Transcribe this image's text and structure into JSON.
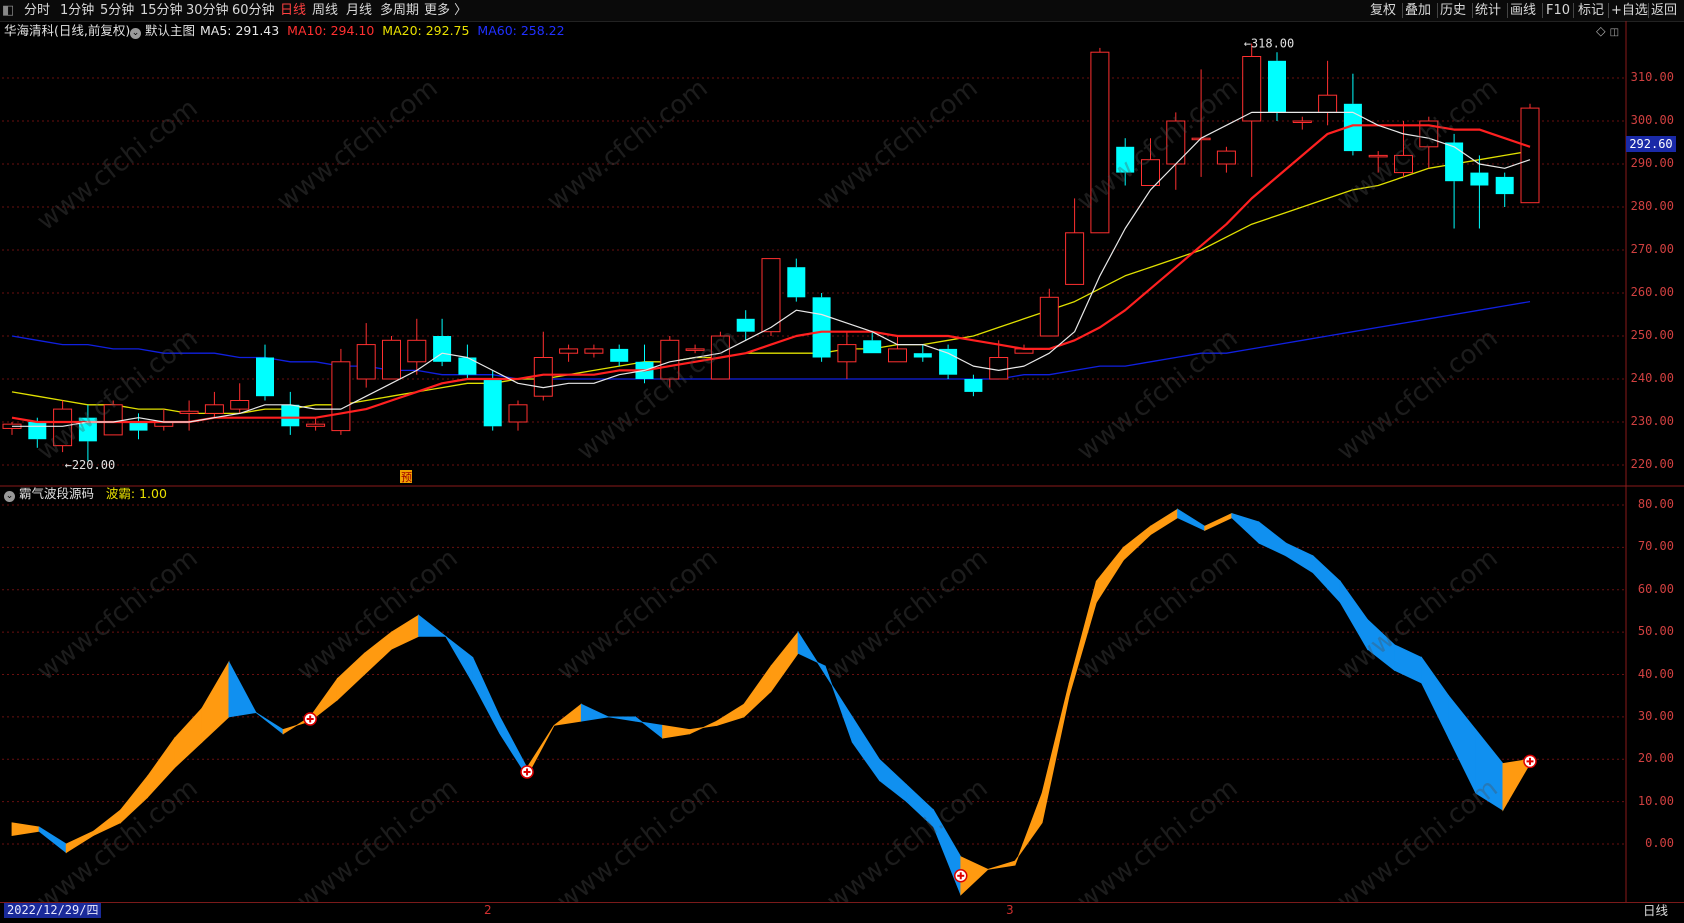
{
  "toolbar": {
    "timeframes": [
      "分时",
      "1分钟",
      "5分钟",
      "15分钟",
      "30分钟",
      "60分钟",
      "日线",
      "周线",
      "月线",
      "多周期",
      "更多 〉"
    ],
    "active_timeframe": "日线",
    "actions": [
      "复权",
      "叠加",
      "历史",
      "统计",
      "画线",
      "F10",
      "标记",
      "+自选",
      "返回"
    ]
  },
  "main_panel": {
    "stock_name": "华海清科(日线,前复权)",
    "template": "默认主图",
    "ma_labels": [
      {
        "text": "MA5: 291.43",
        "color": "#e8e8e8"
      },
      {
        "text": "MA10: 294.10",
        "color": "#ff3030"
      },
      {
        "text": "MA20: 292.75",
        "color": "#e8e000"
      },
      {
        "text": "MA60: 258.22",
        "color": "#2030ff"
      }
    ],
    "price_ticks": [
      "310.00",
      "300.00",
      "290.00",
      "280.00",
      "270.00",
      "260.00",
      "250.00",
      "240.00",
      "230.00",
      "220.00"
    ],
    "current_price": "292.60",
    "high_label": "318.00",
    "low_label": "220.00",
    "yu_label": "预"
  },
  "sub_panel": {
    "indicator_name": "霸气波段源码",
    "param_label": "波霸: 1.00",
    "ticks": [
      "80.00",
      "70.00",
      "60.00",
      "50.00",
      "40.00",
      "30.00",
      "20.00",
      "10.00",
      "0.00"
    ]
  },
  "bottom": {
    "date": "2022/12/29/四",
    "month_marks": [
      "2",
      "3"
    ],
    "period": "日线"
  },
  "watermark_text": "www.cfchi.com",
  "colors": {
    "up": "#ff3030",
    "down": "#00ffff",
    "ma5": "#e8e8e8",
    "ma10": "#ff2020",
    "ma20": "#e0e000",
    "ma60": "#1020e0",
    "band_up": "#ff9a10",
    "band_down": "#1090f0",
    "grid": "#6a1010"
  },
  "chart_data": [
    {
      "type": "candlestick",
      "title": "华海清科(日线,前复权)",
      "ylim": [
        215,
        318
      ],
      "candles": [
        [
          228.5,
          229.5,
          227,
          230
        ],
        [
          230,
          226,
          224,
          231
        ],
        [
          224.5,
          233,
          223,
          235
        ],
        [
          231,
          225.5,
          221,
          234
        ],
        [
          227,
          234,
          228,
          235
        ],
        [
          230,
          228,
          226,
          232
        ],
        [
          229,
          230,
          228,
          233
        ],
        [
          232,
          232.5,
          228,
          235
        ],
        [
          232,
          234,
          231,
          237
        ],
        [
          233,
          235,
          232,
          239
        ],
        [
          245,
          236,
          235,
          248
        ],
        [
          234,
          229,
          227,
          237
        ],
        [
          229,
          229.5,
          228,
          231
        ],
        [
          228,
          244,
          227,
          247
        ],
        [
          240,
          248,
          238,
          253
        ],
        [
          240,
          249,
          240,
          250
        ],
        [
          244,
          249,
          241,
          254
        ],
        [
          250,
          244,
          243,
          254
        ],
        [
          245,
          241,
          240,
          248
        ],
        [
          240,
          229,
          228,
          242
        ],
        [
          230,
          234,
          228,
          235
        ],
        [
          236,
          245,
          235,
          251
        ],
        [
          246,
          247,
          244,
          248
        ],
        [
          246,
          247,
          245,
          248
        ],
        [
          247,
          244,
          243,
          248
        ],
        [
          244,
          240,
          239,
          248
        ],
        [
          240,
          249,
          238,
          250
        ],
        [
          247,
          247,
          246,
          248
        ],
        [
          240,
          250,
          240,
          251
        ],
        [
          254,
          251,
          249,
          256
        ],
        [
          251,
          268,
          250,
          268
        ],
        [
          266,
          259,
          258,
          268
        ],
        [
          259,
          245,
          244,
          260
        ],
        [
          244,
          248,
          240,
          251
        ],
        [
          249,
          246,
          246,
          251
        ],
        [
          244,
          247,
          244,
          250
        ],
        [
          246,
          245,
          244,
          248
        ],
        [
          247,
          241,
          240,
          248
        ],
        [
          240,
          237,
          236,
          241
        ],
        [
          240,
          245,
          240,
          249
        ],
        [
          246,
          247,
          246,
          248
        ],
        [
          250,
          259,
          250,
          261
        ],
        [
          262,
          274,
          262,
          282
        ],
        [
          274,
          316,
          274,
          317
        ],
        [
          294,
          288,
          285,
          296
        ],
        [
          285,
          291,
          285,
          296
        ],
        [
          290,
          300,
          284,
          302
        ],
        [
          296,
          296,
          287,
          312
        ],
        [
          290,
          293,
          288,
          294
        ],
        [
          300,
          315,
          287,
          318
        ],
        [
          314,
          302,
          300,
          316
        ],
        [
          300,
          300,
          298,
          301
        ],
        [
          302,
          306,
          299,
          314
        ],
        [
          304,
          293,
          292,
          311
        ],
        [
          292,
          292,
          288,
          293
        ],
        [
          288,
          292,
          287,
          300
        ],
        [
          294,
          300,
          289,
          301
        ],
        [
          295,
          286,
          275,
          297
        ],
        [
          288,
          285,
          275,
          292
        ],
        [
          287,
          283,
          280,
          288
        ],
        [
          281,
          303,
          281,
          304
        ]
      ],
      "ma5": [
        229,
        229,
        229,
        230,
        230,
        231,
        230,
        230,
        231,
        232,
        234,
        234,
        233,
        233,
        236,
        239,
        242,
        246,
        245,
        242,
        239,
        238,
        239,
        239,
        241,
        242,
        244,
        245,
        246,
        249,
        252,
        256,
        255,
        253,
        251,
        248,
        248,
        246,
        243,
        242,
        243,
        246,
        251,
        264,
        275,
        284,
        290,
        296,
        299,
        302,
        302,
        302,
        302,
        302,
        299,
        297,
        296,
        294,
        290,
        289,
        291
      ],
      "ma10": [
        231,
        230,
        230,
        230,
        230,
        230,
        230,
        230,
        231,
        231,
        231,
        231,
        231,
        232,
        233,
        235,
        237,
        239,
        240,
        240,
        240,
        241,
        241,
        241,
        242,
        242,
        243,
        244,
        245,
        246,
        248,
        250,
        251,
        251,
        251,
        250,
        250,
        250,
        249,
        248,
        247,
        247,
        249,
        252,
        256,
        261,
        266,
        271,
        276,
        282,
        287,
        292,
        297,
        299,
        299,
        299,
        299,
        298,
        298,
        296,
        294
      ],
      "ma20": [
        237,
        236,
        235,
        234,
        234,
        233,
        233,
        232,
        232,
        232,
        233,
        233,
        234,
        234,
        235,
        236,
        237,
        238,
        239,
        239,
        240,
        240,
        241,
        242,
        243,
        244,
        244,
        245,
        245,
        246,
        246,
        246,
        246,
        247,
        247,
        248,
        248,
        249,
        250,
        252,
        254,
        256,
        258,
        261,
        264,
        266,
        268,
        270,
        273,
        276,
        278,
        280,
        282,
        284,
        285,
        287,
        289,
        290,
        291,
        292,
        293
      ],
      "ma60": [
        250,
        249,
        248,
        248,
        247,
        247,
        246,
        246,
        246,
        245,
        245,
        244,
        244,
        243,
        243,
        242,
        242,
        241,
        241,
        241,
        240,
        240,
        240,
        240,
        240,
        240,
        240,
        240,
        240,
        240,
        240,
        240,
        240,
        240,
        240,
        240,
        240,
        240,
        240,
        240,
        241,
        241,
        242,
        243,
        243,
        244,
        245,
        246,
        246,
        247,
        248,
        249,
        250,
        251,
        252,
        253,
        254,
        255,
        256,
        257,
        258
      ]
    },
    {
      "type": "area",
      "title": "霸气波段源码",
      "ylim": [
        -12,
        82
      ],
      "series": [
        {
          "values": [
            5,
            4,
            0,
            3,
            8,
            16,
            25,
            32,
            43,
            31,
            26,
            30,
            39,
            45,
            50,
            54,
            49,
            44,
            30,
            18,
            28,
            33,
            30,
            30,
            25,
            26,
            29,
            33,
            42,
            50,
            40,
            30,
            20,
            14,
            8,
            -3,
            -6,
            -5,
            12,
            38,
            62,
            70,
            75,
            79,
            75,
            78,
            76,
            71,
            68,
            62,
            53,
            47,
            44,
            35,
            27,
            19,
            20
          ],
          "name": "上轨"
        },
        {
          "values": [
            2,
            3,
            -2,
            2,
            5,
            11,
            18,
            24,
            30,
            31,
            27,
            29,
            34,
            40,
            46,
            49,
            49,
            38,
            26,
            16,
            28,
            29,
            30,
            29,
            28,
            27,
            28,
            30,
            36,
            45,
            42,
            24,
            15,
            10,
            4,
            -12,
            -6,
            -4,
            5,
            35,
            57,
            67,
            73,
            77,
            74,
            77,
            71,
            68,
            64,
            57,
            46,
            41,
            38,
            25,
            12,
            8,
            19
          ],
          "name": "下轨"
        }
      ],
      "markers_at_index": [
        11,
        19,
        35,
        56
      ]
    }
  ]
}
